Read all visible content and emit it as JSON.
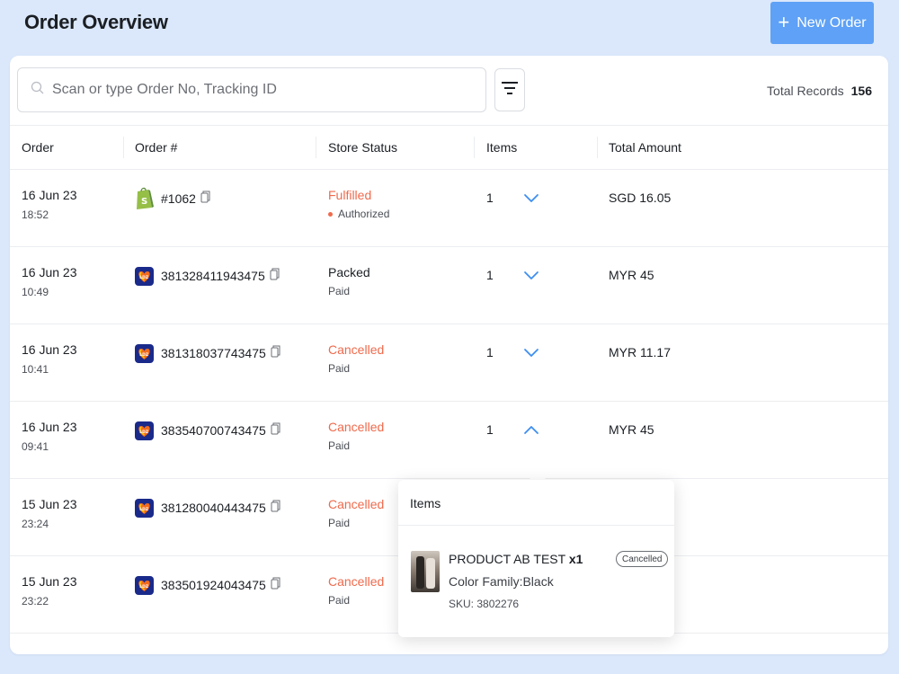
{
  "header": {
    "title": "Order Overview",
    "new_order_label": "New Order"
  },
  "search": {
    "placeholder": "Scan or type Order No, Tracking ID"
  },
  "total_records": {
    "label": "Total Records",
    "value": "156"
  },
  "columns": [
    "Order",
    "Order #",
    "Store Status",
    "Items",
    "Total Amount"
  ],
  "orders": [
    {
      "date": "16 Jun 23",
      "time": "18:52",
      "platform": "shopify",
      "order_no": "#1062",
      "status": "Fulfilled",
      "status_color": "red",
      "payment": "Authorized",
      "payment_dot": true,
      "items": "1",
      "expanded": false,
      "amount": "SGD 16.05"
    },
    {
      "date": "16 Jun 23",
      "time": "10:49",
      "platform": "lazada",
      "order_no": "381328411943475",
      "status": "Packed",
      "status_color": "dark",
      "payment": "Paid",
      "payment_dot": false,
      "items": "1",
      "expanded": false,
      "amount": "MYR 45"
    },
    {
      "date": "16 Jun 23",
      "time": "10:41",
      "platform": "lazada",
      "order_no": "381318037743475",
      "status": "Cancelled",
      "status_color": "red",
      "payment": "Paid",
      "payment_dot": false,
      "items": "1",
      "expanded": false,
      "amount": "MYR 11.17"
    },
    {
      "date": "16 Jun 23",
      "time": "09:41",
      "platform": "lazada",
      "order_no": "383540700743475",
      "status": "Cancelled",
      "status_color": "red",
      "payment": "Paid",
      "payment_dot": false,
      "items": "1",
      "expanded": true,
      "amount": "MYR 45"
    },
    {
      "date": "15 Jun 23",
      "time": "23:24",
      "platform": "lazada",
      "order_no": "381280040443475",
      "status": "Cancelled",
      "status_color": "red",
      "payment": "Paid",
      "payment_dot": false,
      "items": "",
      "expanded": false,
      "amount": ""
    },
    {
      "date": "15 Jun 23",
      "time": "23:22",
      "platform": "lazada",
      "order_no": "383501924043475",
      "status": "Cancelled",
      "status_color": "red",
      "payment": "Paid",
      "payment_dot": false,
      "items": "",
      "expanded": false,
      "amount": ""
    }
  ],
  "items_popover": {
    "title": "Items",
    "product_name": "PRODUCT AB TEST",
    "quantity": "x1",
    "variant": "Color Family:Black",
    "sku": "SKU: 3802276",
    "badge": "Cancelled"
  },
  "colors": {
    "accent": "#5ea1f6",
    "chevron": "#3d8ef0",
    "status_red": "#ef6a4c",
    "background": "#dbe8fb"
  },
  "icons": {
    "search": "search-icon",
    "filter": "filter-icon",
    "copy": "copy-icon",
    "plus": "plus-icon",
    "chevron_down": "chevron-down-icon",
    "chevron_up": "chevron-up-icon",
    "shopify": "shopify-logo-icon",
    "lazada": "lazada-logo-icon"
  }
}
